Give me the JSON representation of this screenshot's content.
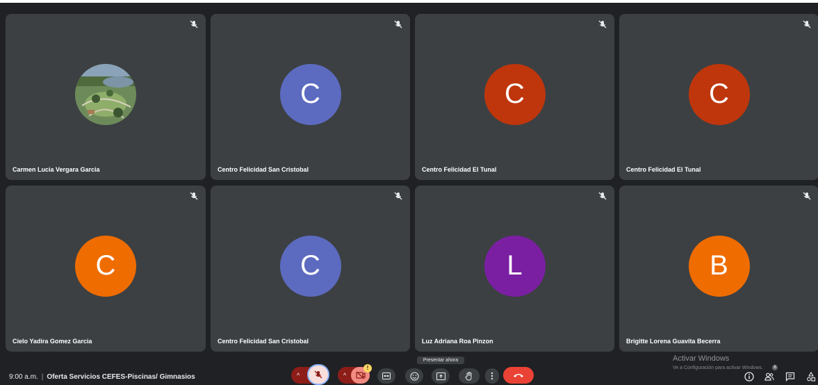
{
  "tiles": [
    {
      "name": "Carmen Lucia Vergara Garcia",
      "initial": "",
      "color": "",
      "photo": true
    },
    {
      "name": "Centro Felicidad San Cristobal",
      "initial": "C",
      "color": "#5c6bc0"
    },
    {
      "name": "Centro Felicidad El Tunal",
      "initial": "C",
      "color": "#bf360c"
    },
    {
      "name": "Centro Felicidad El Tunal",
      "initial": "C",
      "color": "#bf360c"
    },
    {
      "name": "Cielo Yadira Gomez Garcia",
      "initial": "C",
      "color": "#ef6c00"
    },
    {
      "name": "Centro Felicidad San Cristobal",
      "initial": "C",
      "color": "#5c6bc0"
    },
    {
      "name": "Luz Adriana Roa Pinzon",
      "initial": "L",
      "color": "#7b1fa2"
    },
    {
      "name": "Brigitte Lorena Guavita Becerra",
      "initial": "B",
      "color": "#ef6c00"
    }
  ],
  "footer": {
    "time": "9:00 a.m.",
    "meeting_title": "Oferta Servicios CEFES-Piscinas/ Gimnasios",
    "present_tooltip": "Presentar ahora",
    "participants_count": "8"
  },
  "watermark": {
    "line1": "Activar Windows",
    "line2": "Ve a Configuración para activar Windows."
  },
  "colors": {
    "background": "#202124",
    "tile": "#3c4043",
    "end_call": "#ea4335",
    "mic_off_bg": "#f9dedc",
    "cam_off_bg": "#f28b82",
    "caret_bg": "#8c1d18"
  }
}
